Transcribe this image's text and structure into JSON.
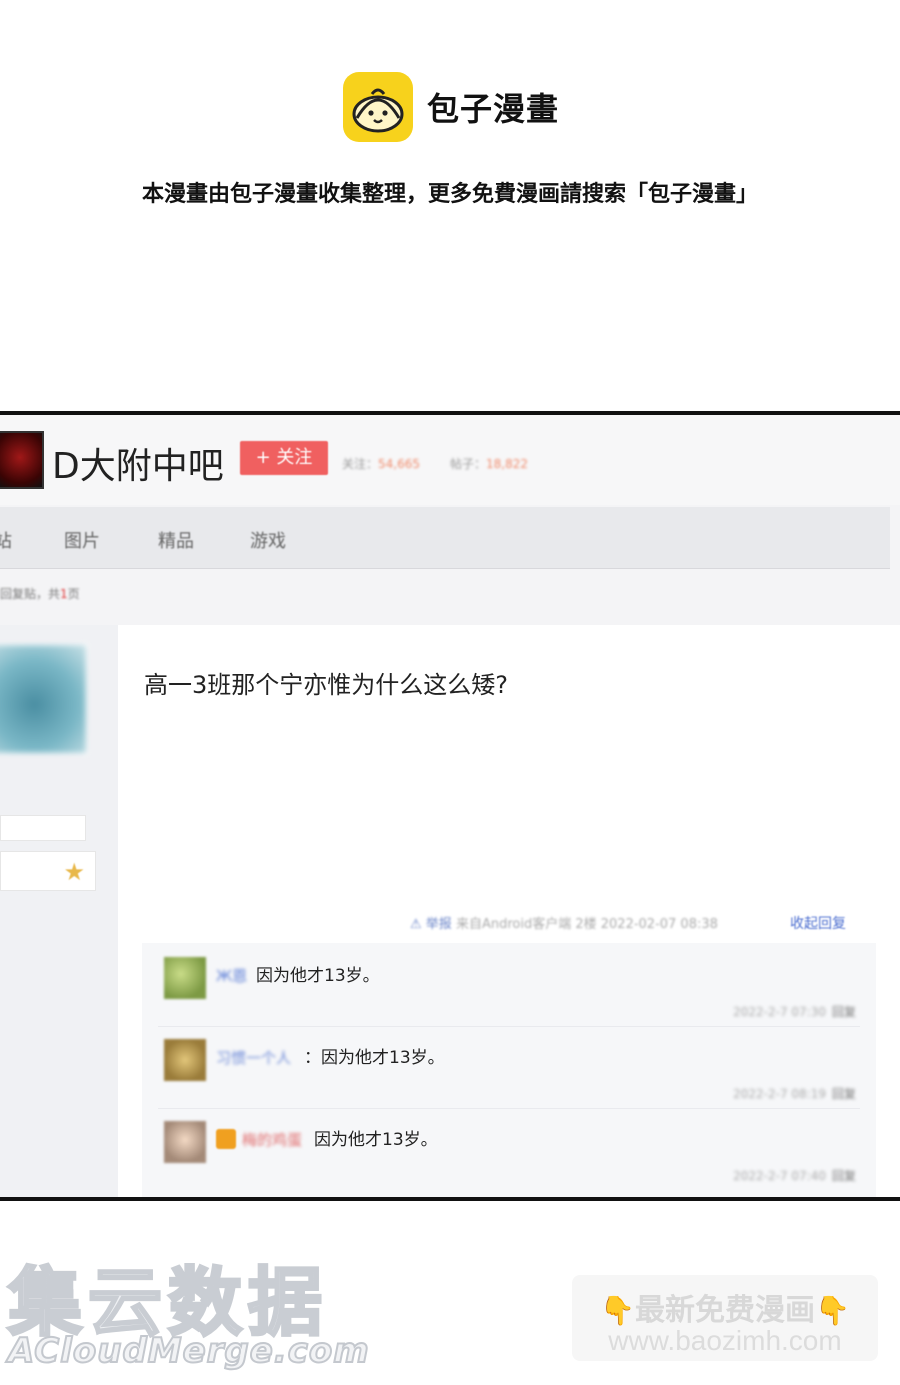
{
  "banner": {
    "brand_name": "包子漫畫",
    "tagline": "本漫畫由包子漫畫收集整理，更多免費漫画請搜索「包子漫畫」"
  },
  "forum": {
    "name": "D大附中吧",
    "follow_label": "+ 关注",
    "stats": [
      {
        "label": "关注：",
        "value": "54,665"
      },
      {
        "label": "帖子：",
        "value": "18,822"
      }
    ],
    "nav": [
      "站",
      "图片",
      "精品",
      "游戏"
    ],
    "breadcrumb_prefix": "回复贴，共",
    "breadcrumb_count": "1",
    "breadcrumb_suffix": "页"
  },
  "post": {
    "title": "高一3班那个宁亦惟为什么这么矮?",
    "report_label": "举报",
    "meta": "来自Android客户端 2楼 2022-02-07 08:38",
    "collapse_label": "收起回复",
    "replies": [
      {
        "user": "Ж恩",
        "text": "因为他才13岁。",
        "time": "2022-2-7 07:30",
        "reply_label": "回复"
      },
      {
        "user": "习惯一个人",
        "text": "：因为他才13岁。",
        "time": "2022-2-7 08:19",
        "reply_label": "回复"
      },
      {
        "user": "梅的鸡蛋",
        "text": "因为他才13岁。",
        "time": "2022-2-7 07:40",
        "reply_label": "回复"
      }
    ]
  },
  "footer": {
    "watermark_big": "集云数据",
    "watermark_small": "ACloudMerge.com",
    "promo_title": "最新免费漫画",
    "promo_url": "www.baozimh.com",
    "hand_icon": "👇"
  },
  "colors": {
    "brand_yellow": "#f7d21c",
    "follow_red": "#f06060",
    "link_blue": "#4d6fd0"
  }
}
